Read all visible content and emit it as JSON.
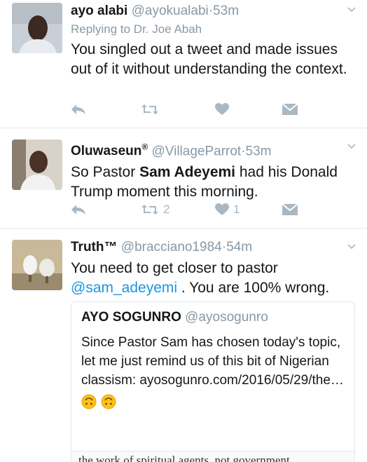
{
  "tweets": [
    {
      "name": "ayo alabi",
      "handle": "@ayokualabi",
      "time": "53m",
      "reply_to_prefix": "Replying to",
      "reply_to_user": "Dr. Joe Abah",
      "text": "You singled out a tweet and made issues out of it without understanding the context.",
      "retweets": "",
      "likes": ""
    },
    {
      "name": "Oluwaseun",
      "verified_mark": "®",
      "handle": "@VillageParrot",
      "time": "53m",
      "text_before": "So Pastor ",
      "text_bold": "Sam Adeyemi",
      "text_after": " had his Donald Trump moment this morning.",
      "retweets": "2",
      "likes": "1"
    },
    {
      "name": "Truth™",
      "handle": "@bracciano1984",
      "time": "54m",
      "text_before": "You need to get closer to pastor",
      "mention": "@sam_adeyemi",
      "text_after": " . You are 100% wrong.",
      "quote": {
        "name": "AYO SOGUNRO",
        "handle": "@ayosogunro",
        "text": "Since Pastor Sam has chosen today's topic, let me just remind us of this bit of Nigerian classism: ayosogunro.com/2016/05/29/the…",
        "emoji": [
          "upside-down-face",
          "upside-down-face"
        ],
        "image_caption": "the work of spiritual agents, not government"
      }
    }
  ],
  "dot": "·",
  "colors": {
    "text": "#14171a",
    "muted": "#8899a6",
    "icon": "#aab8c2",
    "link": "#1b95e0",
    "border": "#e1e8ed"
  }
}
